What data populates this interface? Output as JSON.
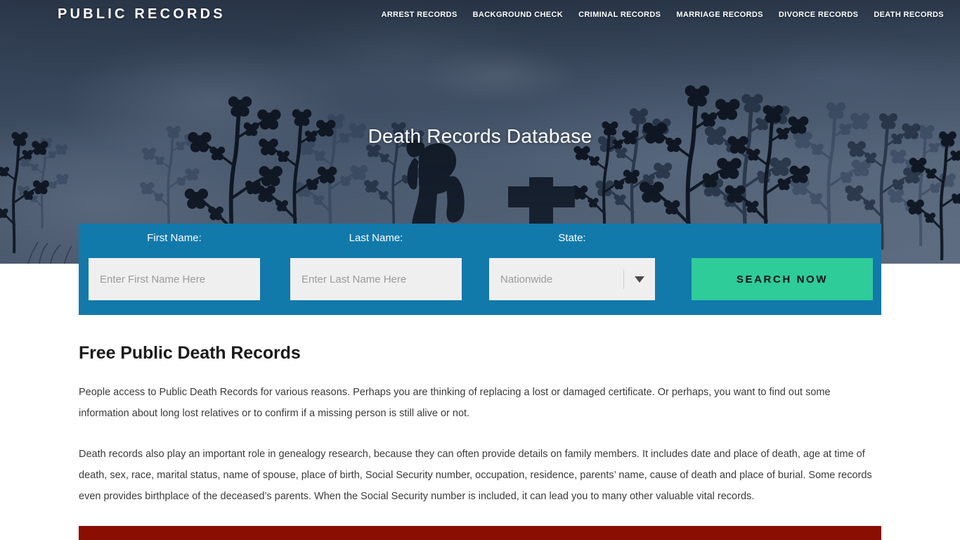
{
  "header": {
    "brand": "PUBLIC RECORDS",
    "nav_items": [
      {
        "label": "ARREST RECORDS"
      },
      {
        "label": "BACKGROUND CHECK"
      },
      {
        "label": "CRIMINAL RECORDS"
      },
      {
        "label": "MARRIAGE RECORDS"
      },
      {
        "label": "DIVORCE RECORDS"
      },
      {
        "label": "DEATH RECORDS"
      }
    ]
  },
  "hero": {
    "title": "Death Records Database",
    "background_description": "dusk sky with silhouetted flowering branches, praying child and cross grave marker"
  },
  "search_form": {
    "panel_color": "#1279ab",
    "first_name": {
      "label": "First Name:",
      "value": "",
      "placeholder": "Enter First Name Here"
    },
    "last_name": {
      "label": "Last Name:",
      "value": "",
      "placeholder": "Enter Last Name Here"
    },
    "state": {
      "label": "State:",
      "selected": "Nationwide",
      "icon": "chevron-down-icon"
    },
    "submit": {
      "label": "SEARCH NOW",
      "color": "#2ecc99"
    }
  },
  "main": {
    "title": "Free Public Death Records",
    "paragraphs": [
      "People access to Public Death Records for various reasons. Perhaps you are thinking of replacing a lost or damaged certificate. Or perhaps, you want to find out some information about long lost relatives or to confirm if a missing person is still alive or not.",
      "Death records also play an important role in genealogy research, because they can often provide details on family members. It includes date and place of death, age at time of death, sex, race, marital status, name of spouse, place of birth, Social Security number, occupation, residence, parents’ name, cause of death and place of burial. Some records even provides birthplace of the deceased’s parents. When the Social Security number is included, it can lead you to many other valuable vital records."
    ]
  },
  "footer_accent": {
    "color": "#8b0e02"
  }
}
